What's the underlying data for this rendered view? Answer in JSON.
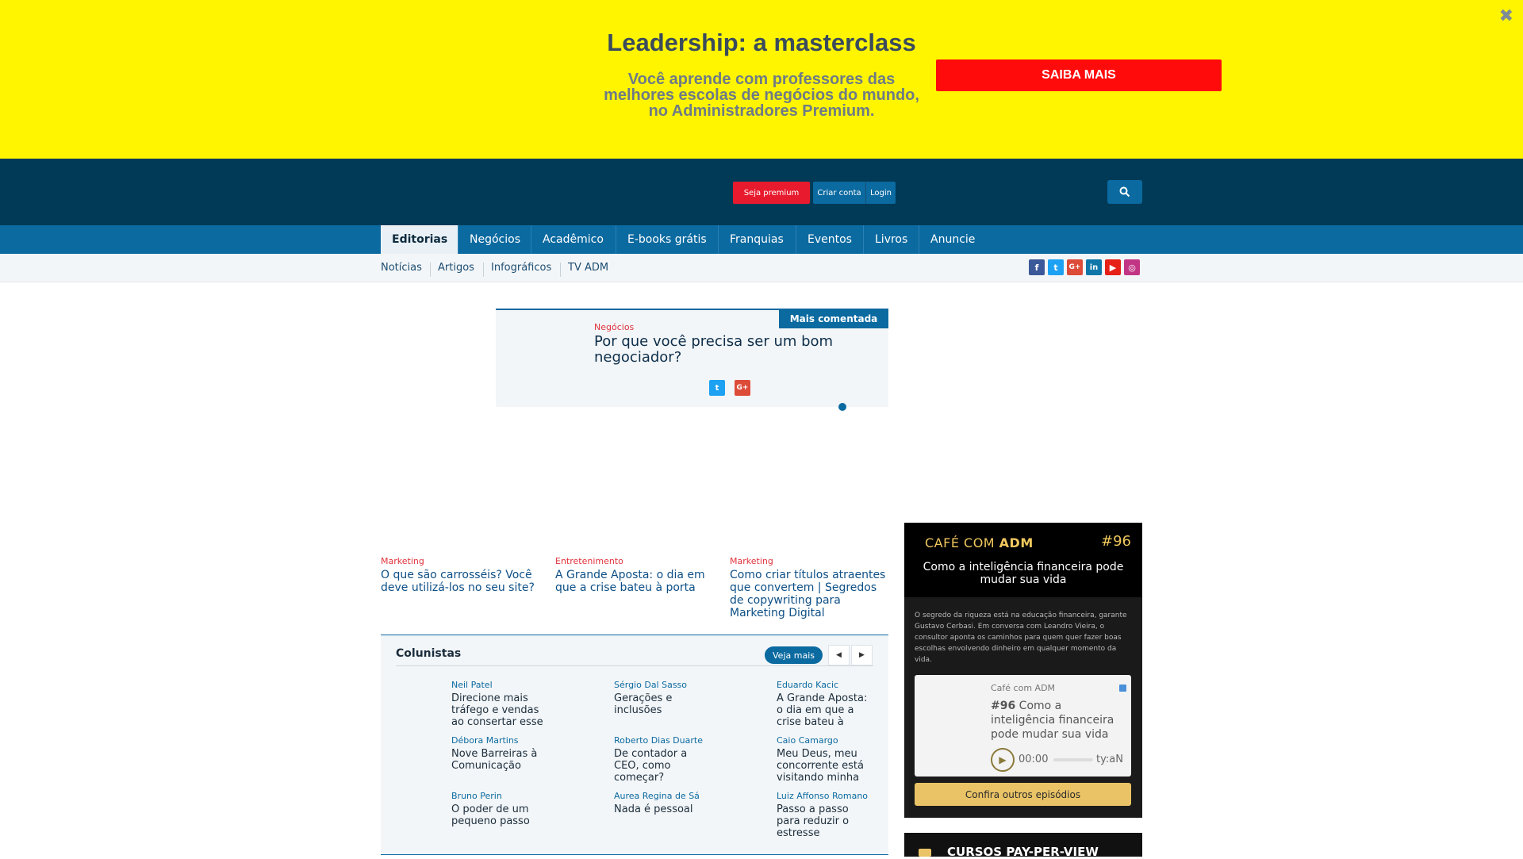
{
  "banner": {
    "title": "Leadership: a masterclass",
    "subtitle": "Você aprende com professores das melhores escolas de negócios do mundo, no Administradores Premium.",
    "cta": "SAIBA MAIS",
    "close_icon": "close-icon",
    "bg_color": "#fff500",
    "cta_color": "#ff0b0b"
  },
  "header": {
    "premium": "Seja premium",
    "criar": "Criar conta",
    "login": "Login",
    "search_icon": "search-icon",
    "bg_color": "#003a57"
  },
  "mainnav": {
    "items": [
      "Editorias",
      "Negócios",
      "Acadêmico",
      "E-books grátis",
      "Franquias",
      "Eventos",
      "Livros",
      "Anuncie"
    ],
    "active": "Editorias"
  },
  "subnav": {
    "items": [
      "Notícias",
      "Artigos",
      "Infográficos",
      "TV ADM"
    ],
    "social": [
      "facebook-icon",
      "twitter-icon",
      "google-plus-icon",
      "linkedin-icon",
      "youtube-icon",
      "instagram-icon"
    ]
  },
  "featured": {
    "tag": "Mais comentada",
    "category": "Negócios",
    "title": "Por que você precisa ser um bom negociador?",
    "share": [
      "twitter-icon",
      "google-plus-icon"
    ]
  },
  "cards": [
    {
      "category": "Marketing",
      "title": "O que são carrosséis? Você deve utilizá-los no seu site?"
    },
    {
      "category": "Entretenimento",
      "title": "A Grande Aposta: o dia em que a crise bateu à porta"
    },
    {
      "category": "Marketing",
      "title": "Como criar títulos atraentes que convertem | Segredos de copywriting para Marketing Digital"
    }
  ],
  "colunistas": {
    "title": "Colunistas",
    "veja_mais": "Veja mais",
    "items": [
      {
        "author": "Neil Patel",
        "headline": "Direcione mais tráfego e vendas ao consertar esse"
      },
      {
        "author": "Sérgio Dal Sasso",
        "headline": "Gerações e inclusões"
      },
      {
        "author": "Eduardo Kacic",
        "headline": "A Grande Aposta: o dia em que a crise bateu à"
      },
      {
        "author": "Débora Martins",
        "headline": "Nove Barreiras à Comunicação"
      },
      {
        "author": "Roberto Dias Duarte",
        "headline": "De contador a CEO, como começar?"
      },
      {
        "author": "Caio Camargo",
        "headline": "Meu Deus, meu concorrente está visitando minha"
      },
      {
        "author": "Bruno Perin",
        "headline": "O poder de um pequeno passo"
      },
      {
        "author": "Aurea Regina de Sá",
        "headline": "Nada é pessoal"
      },
      {
        "author": "Luiz Affonso Romano",
        "headline": "Passo a passo para reduzir o estresse"
      }
    ]
  },
  "podcast": {
    "brand_light": "CAFÉ COM ",
    "brand_bold": "ADM",
    "episode": "#96",
    "title": "Como a inteligência financeira pode mudar sua vida",
    "description": "O segredo da riqueza está na educação financeira, garante Gustavo Cerbasi. Em conversa com Leandro Vieira, o consultor aponta os caminhos para quem quer fazer boas escolhas envolvendo dinheiro em qualquer momento da vida.",
    "player": {
      "show": "Café com ADM",
      "episode_number": "#96",
      "episode_title": " Como a inteligência financeira pode mudar sua vida",
      "time": "00:00",
      "duration": "ty:aN",
      "progress": 0
    },
    "confira": "Confira outros episódios"
  },
  "cursos": {
    "label": "CURSOS PAY-PER-VIEW"
  }
}
